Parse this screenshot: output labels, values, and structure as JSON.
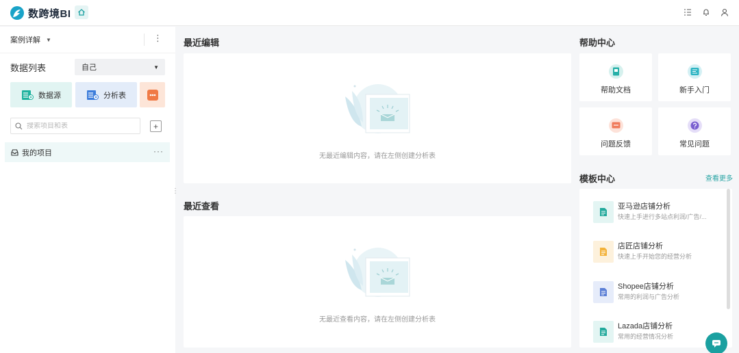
{
  "app": {
    "name": "数跨境BI"
  },
  "sidebar": {
    "case_title": "案例详解",
    "data_list_label": "数据列表",
    "owner_value": "自己",
    "quick_datasource": "数据源",
    "quick_analysis": "分析表",
    "search_placeholder": "搜索项目和表",
    "project": "我的项目"
  },
  "main": {
    "recent_edit_title": "最近编辑",
    "recent_edit_empty": "无最近编辑内容，请在左侧创建分析表",
    "recent_view_title": "最近查看",
    "recent_view_empty": "无最近查看内容，请在左侧创建分析表"
  },
  "help": {
    "title": "帮助中心",
    "items": [
      {
        "label": "帮助文档",
        "icon": "document-icon",
        "color": "#26b0a8"
      },
      {
        "label": "新手入门",
        "icon": "guide-icon",
        "color": "#2ab3c2"
      },
      {
        "label": "问题反馈",
        "icon": "feedback-icon",
        "color": "#f07b5b"
      },
      {
        "label": "常见问题",
        "icon": "question-icon",
        "color": "#7a5fd0"
      }
    ]
  },
  "templates": {
    "title": "模板中心",
    "see_more": "查看更多",
    "items": [
      {
        "name": "亚马逊店铺分析",
        "desc": "快速上手进行多站点利润/广告/...",
        "color": "#22a99c"
      },
      {
        "name": "店匠店铺分析",
        "desc": "快速上手开始您的经营分析",
        "color": "#f3b23a"
      },
      {
        "name": "Shopee店铺分析",
        "desc": "常用的利润与广告分析",
        "color": "#5b7fd6"
      },
      {
        "name": "Lazada店铺分析",
        "desc": "常用的经营情况分析",
        "color": "#22a99c"
      }
    ]
  }
}
